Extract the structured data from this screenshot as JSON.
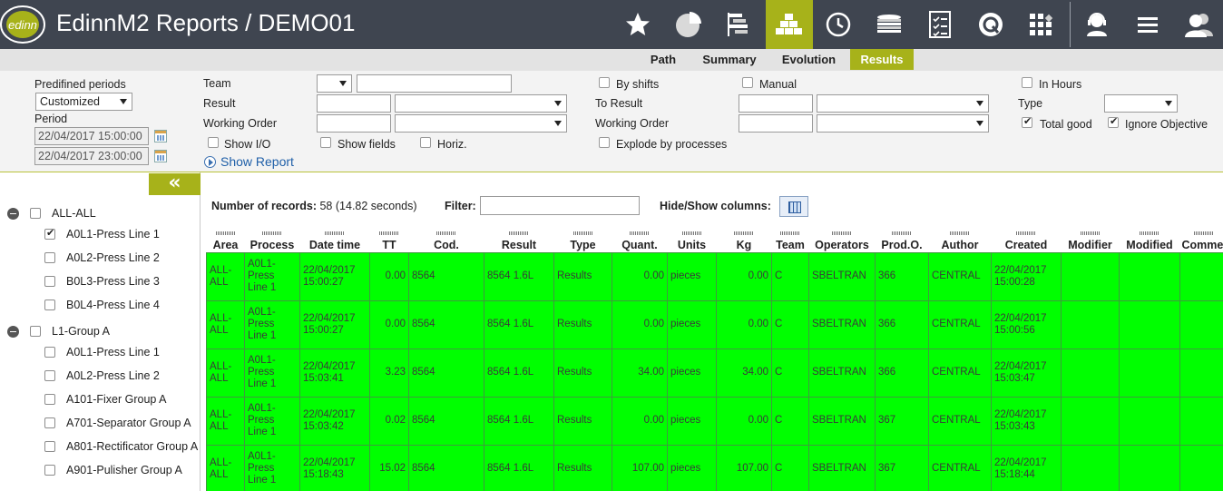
{
  "header": {
    "logo_text": "edinn",
    "title": "EdinnM2 Reports / DEMO01",
    "nav_icons": [
      {
        "name": "star-icon",
        "active": false
      },
      {
        "name": "pie-chart-icon",
        "active": false
      },
      {
        "name": "gantt-icon",
        "active": false
      },
      {
        "name": "stacked-boxes-icon",
        "active": true
      },
      {
        "name": "clock-icon",
        "active": false
      },
      {
        "name": "coins-stack-icon",
        "active": false
      },
      {
        "name": "checklist-icon",
        "active": false
      },
      {
        "name": "q-quality-icon",
        "active": false
      },
      {
        "name": "grid-apps-icon",
        "active": false
      },
      {
        "name": "support-agent-icon",
        "active": false
      },
      {
        "name": "hamburger-menu-icon",
        "active": false
      },
      {
        "name": "users-icon",
        "active": false
      }
    ]
  },
  "subtabs": [
    {
      "label": "Path",
      "active": false
    },
    {
      "label": "Summary",
      "active": false
    },
    {
      "label": "Evolution",
      "active": false
    },
    {
      "label": "Results",
      "active": true
    }
  ],
  "filters": {
    "predefined_periods_label": "Predifined periods",
    "predefined_periods_value": "Customized",
    "period_label": "Period",
    "period_start": "22/04/2017 15:00:00",
    "period_end": "22/04/2017 23:00:00",
    "team_label": "Team",
    "result_label": "Result",
    "working_order_label": "Working Order",
    "show_io_label": "Show I/O",
    "show_fields_label": "Show fields",
    "horiz_label": "Horiz.",
    "show_report_label": "Show Report",
    "by_shifts_label": "By shifts",
    "manual_label": "Manual",
    "to_result_label": "To Result",
    "working_order2_label": "Working Order",
    "explode_label": "Explode by processes",
    "in_hours_label": "In Hours",
    "type_label": "Type",
    "total_good_label": "Total good",
    "ignore_objective_label": "Ignore Objective"
  },
  "tree": {
    "collapse_label": "«",
    "groups": [
      {
        "label": "ALL-ALL",
        "items": [
          {
            "label": "A0L1-Press Line 1",
            "checked": true
          },
          {
            "label": "A0L2-Press Line 2",
            "checked": false
          },
          {
            "label": "B0L3-Press Line 3",
            "checked": false
          },
          {
            "label": "B0L4-Press Line 4",
            "checked": false
          }
        ]
      },
      {
        "label": "L1-Group A",
        "items": [
          {
            "label": "A0L1-Press Line 1",
            "checked": false
          },
          {
            "label": "A0L2-Press Line 2",
            "checked": false
          },
          {
            "label": "A101-Fixer Group A",
            "checked": false
          },
          {
            "label": "A701-Separator Group A",
            "checked": false
          },
          {
            "label": "A801-Rectificator Group A",
            "checked": false
          },
          {
            "label": "A901-Pulisher Group A",
            "checked": false
          }
        ]
      }
    ]
  },
  "results": {
    "records_label": "Number of records:",
    "records_count": "58",
    "records_time": "(14.82 seconds)",
    "filter_label": "Filter:",
    "hide_show_label": "Hide/Show columns:",
    "columns": [
      "Area",
      "Process",
      "Date time",
      "TT",
      "Cod.",
      "Result",
      "Type",
      "Quant.",
      "Units",
      "Kg",
      "Team",
      "Operators",
      "Prod.O.",
      "Author",
      "Created",
      "Modifier",
      "Modified",
      "Commen"
    ],
    "rows": [
      [
        "ALL-ALL",
        "A0L1-Press Line 1",
        "22/04/2017 15:00:27",
        "0.00",
        "8564",
        "8564 1.6L",
        "Results",
        "0.00",
        "pieces",
        "0.00",
        "C",
        "SBELTRAN",
        "366",
        "CENTRAL",
        "22/04/2017 15:00:28",
        "",
        "",
        ""
      ],
      [
        "ALL-ALL",
        "A0L1-Press Line 1",
        "22/04/2017 15:00:27",
        "0.00",
        "8564",
        "8564 1.6L",
        "Results",
        "0.00",
        "pieces",
        "0.00",
        "C",
        "SBELTRAN",
        "366",
        "CENTRAL",
        "22/04/2017 15:00:56",
        "",
        "",
        ""
      ],
      [
        "ALL-ALL",
        "A0L1-Press Line 1",
        "22/04/2017 15:03:41",
        "3.23",
        "8564",
        "8564 1.6L",
        "Results",
        "34.00",
        "pieces",
        "34.00",
        "C",
        "SBELTRAN",
        "366",
        "CENTRAL",
        "22/04/2017 15:03:47",
        "",
        "",
        ""
      ],
      [
        "ALL-ALL",
        "A0L1-Press Line 1",
        "22/04/2017 15:03:42",
        "0.02",
        "8564",
        "8564 1.6L",
        "Results",
        "0.00",
        "pieces",
        "0.00",
        "C",
        "SBELTRAN",
        "367",
        "CENTRAL",
        "22/04/2017 15:03:43",
        "",
        "",
        ""
      ],
      [
        "ALL-ALL",
        "A0L1-Press Line 1",
        "22/04/2017 15:18:43",
        "15.02",
        "8564",
        "8564 1.6L",
        "Results",
        "107.00",
        "pieces",
        "107.00",
        "C",
        "SBELTRAN",
        "367",
        "CENTRAL",
        "22/04/2017 15:18:44",
        "",
        "",
        ""
      ]
    ],
    "row_color": "#00ff00"
  }
}
